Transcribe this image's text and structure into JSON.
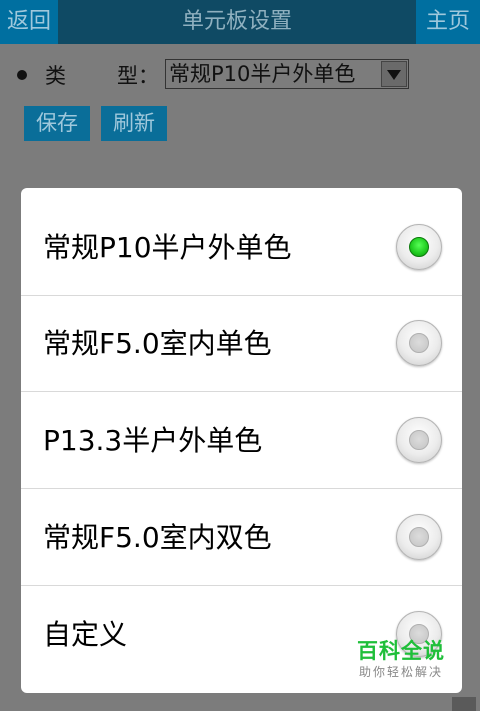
{
  "topbar": {
    "back_label": "返回",
    "title": "单元板设置",
    "home_label": "主页"
  },
  "form": {
    "type_label_part1": "类",
    "type_label_part2": "型：",
    "selected_type": "常规P10半户外单色"
  },
  "actions": {
    "save_label": "保存",
    "refresh_label": "刷新"
  },
  "dialog": {
    "options": [
      {
        "label": "常规P10半户外单色",
        "checked": true
      },
      {
        "label": "常规F5.0室内单色",
        "checked": false
      },
      {
        "label": "P13.3半户外单色",
        "checked": false
      },
      {
        "label": "常规F5.0室内双色",
        "checked": false
      },
      {
        "label": "自定义",
        "checked": false
      }
    ]
  },
  "watermark": {
    "main": "百科全说",
    "sub": "助你轻松解决"
  },
  "colors": {
    "accent": "#006fa0",
    "radio_selected": "#1ec91e",
    "watermark": "#1fbf3a"
  }
}
